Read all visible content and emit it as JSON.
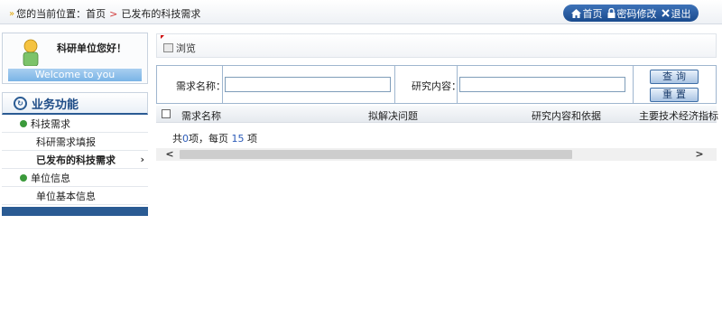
{
  "breadcrumb": {
    "prefix": "您的当前位置：",
    "home": "首页",
    "separator": ">",
    "current": "已发布的科技需求"
  },
  "quick_links": [
    {
      "label": "首页",
      "icon": "home-icon"
    },
    {
      "label": "密码修改",
      "icon": "lock-icon"
    },
    {
      "label": "退出",
      "icon": "close-icon"
    }
  ],
  "welcome": {
    "greeting": "科研单位您好！",
    "banner": "Welcome to you"
  },
  "sidebar": {
    "title": "业务功能",
    "groups": [
      {
        "label": "科技需求",
        "items": [
          {
            "label": "科研需求填报"
          },
          {
            "label": "已发布的科技需求",
            "active": true
          }
        ]
      },
      {
        "label": "单位信息",
        "items": [
          {
            "label": "单位基本信息"
          }
        ]
      }
    ]
  },
  "browse": {
    "label": "浏览"
  },
  "search": {
    "name_label": "需求名称：",
    "name_value": "",
    "content_label": "研究内容：",
    "content_value": "",
    "query_button": "查询",
    "reset_button": "重置"
  },
  "table": {
    "columns": [
      "需求名称",
      "拟解决问题",
      "研究内容和依据",
      "主要技术经济指标"
    ],
    "rows": []
  },
  "summary": {
    "prefix": "共",
    "total": "0",
    "mid": "项，每页",
    "per_page": "15",
    "suffix": "项"
  },
  "colors": {
    "accent": "#2a5b93",
    "breadcrumb_separator": "#d23c3c",
    "count": "#2a5ab8"
  }
}
